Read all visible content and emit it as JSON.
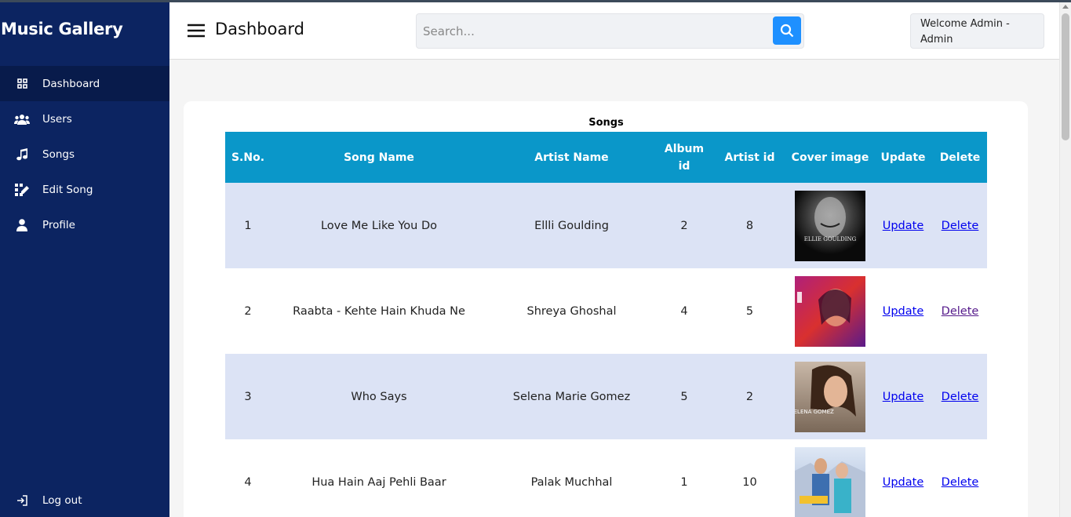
{
  "app": {
    "brand": "Music Gallery"
  },
  "sidebar": {
    "items": [
      {
        "label": "Dashboard",
        "icon": "grid-icon",
        "active": true
      },
      {
        "label": "Users",
        "icon": "users-icon"
      },
      {
        "label": "Songs",
        "icon": "music-note-icon"
      },
      {
        "label": "Edit Song",
        "icon": "edit-song-icon"
      },
      {
        "label": "Profile",
        "icon": "user-icon"
      }
    ],
    "logout_label": "Log out"
  },
  "header": {
    "title": "Dashboard",
    "search_placeholder": "Search...",
    "welcome": "Welcome Admin - Admin"
  },
  "table": {
    "caption": "Songs",
    "columns": [
      "S.No.",
      "Song Name",
      "Artist Name",
      "Album id",
      "Artist id",
      "Cover image",
      "Update",
      "Delete"
    ],
    "rows": [
      {
        "sno": "1",
        "song": "Love Me Like You Do",
        "artist": "Ellli Goulding",
        "album_id": "2",
        "artist_id": "8",
        "cover_text": "ELLIE GOULDING",
        "update": "Update",
        "delete": "Delete"
      },
      {
        "sno": "2",
        "song": "Raabta - Kehte Hain Khuda Ne",
        "artist": "Shreya Ghoshal",
        "album_id": "4",
        "artist_id": "5",
        "cover_text": "",
        "update": "Update",
        "delete": "Delete"
      },
      {
        "sno": "3",
        "song": "Who Says",
        "artist": "Selena Marie Gomez",
        "album_id": "5",
        "artist_id": "2",
        "cover_text": "SELENA GOMEZ",
        "update": "Update",
        "delete": "Delete"
      },
      {
        "sno": "4",
        "song": "Hua Hain Aaj Pehli Baar",
        "artist": "Palak Muchhal",
        "album_id": "1",
        "artist_id": "10",
        "cover_text": "",
        "update": "Update",
        "delete": "Delete"
      }
    ]
  },
  "colors": {
    "sidebar": "#0c2461",
    "header_row": "#0a97c9",
    "odd_row": "#dce3f5",
    "search_button": "#1e90ff"
  }
}
